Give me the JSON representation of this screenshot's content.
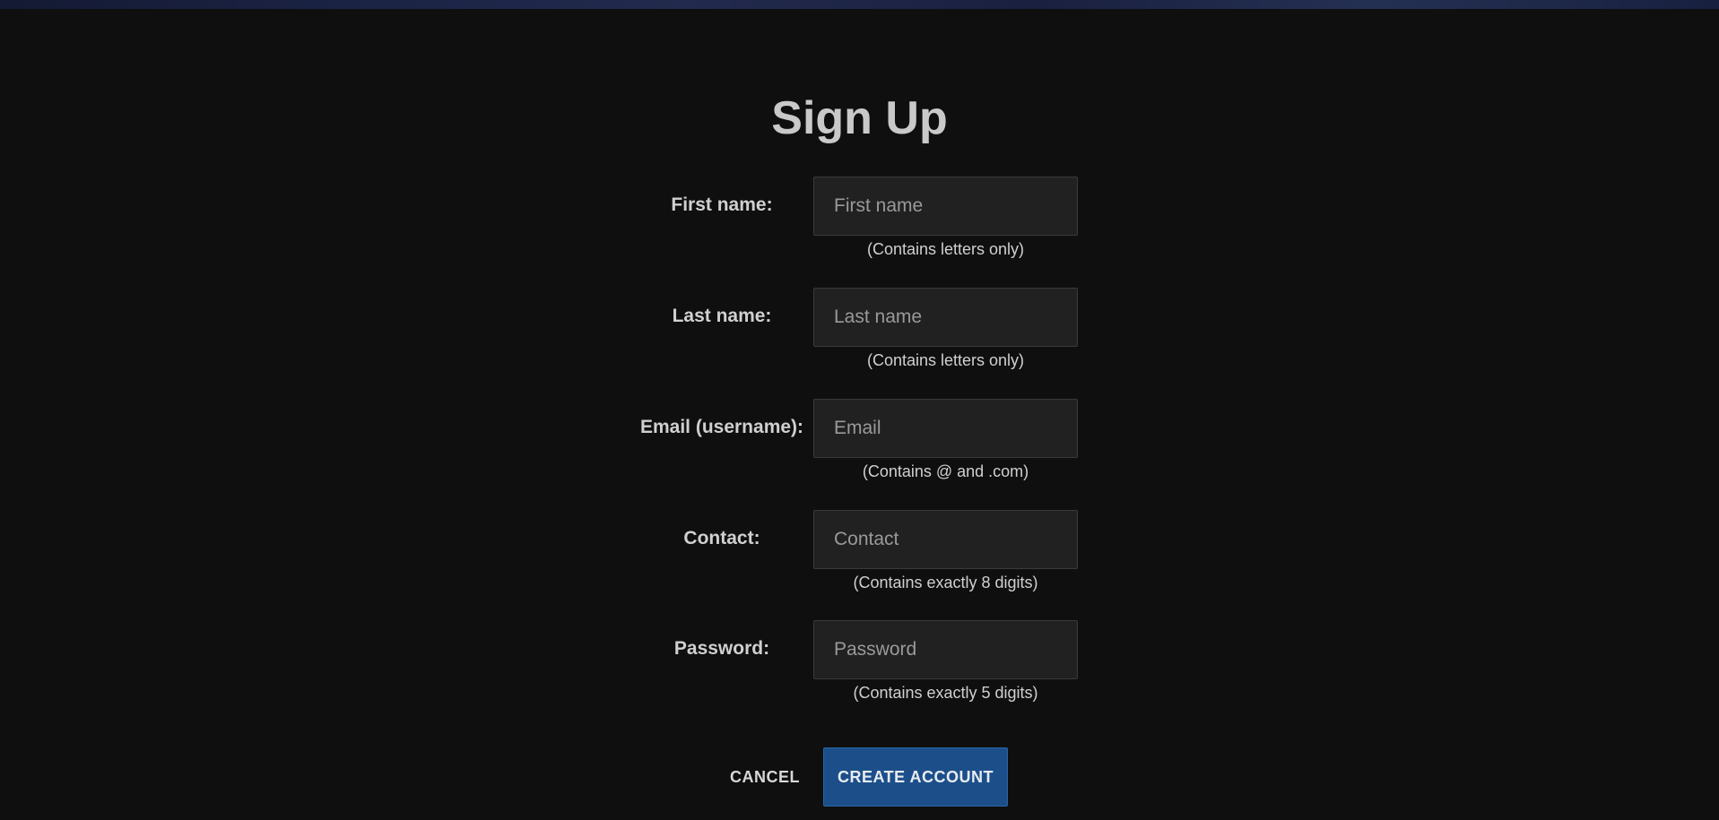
{
  "page": {
    "title": "Sign Up"
  },
  "form": {
    "first_name": {
      "label": "First name:",
      "placeholder": "First name",
      "value": "",
      "hint": "(Contains letters only)"
    },
    "last_name": {
      "label": "Last name:",
      "placeholder": "Last name",
      "value": "",
      "hint": "(Contains letters only)"
    },
    "email": {
      "label": "Email (username):",
      "placeholder": "Email",
      "value": "",
      "hint": "(Contains @ and .com)"
    },
    "contact": {
      "label": "Contact:",
      "placeholder": "Contact",
      "value": "",
      "hint": "(Contains exactly 8 digits)"
    },
    "password": {
      "label": "Password:",
      "placeholder": "Password",
      "value": "",
      "hint": "(Contains exactly 5 digits)"
    }
  },
  "actions": {
    "cancel_label": "CANCEL",
    "create_label": "CREATE ACCOUNT"
  },
  "colors": {
    "background": "#0f0f0f",
    "field_background": "#212121",
    "primary_button": "#1c4f8a",
    "text": "#d0d0d0"
  }
}
